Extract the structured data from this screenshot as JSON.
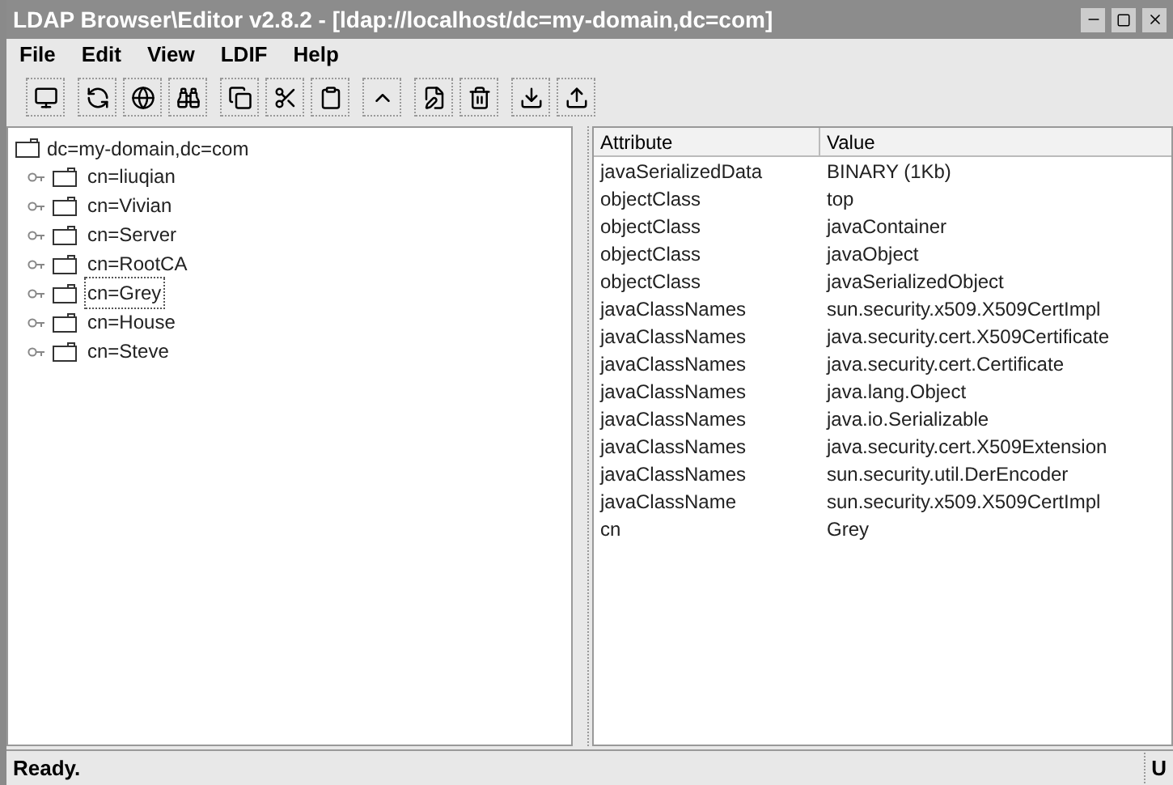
{
  "window": {
    "title": "LDAP Browser\\Editor v2.8.2 - [ldap://localhost/dc=my-domain,dc=com]"
  },
  "menu": [
    "File",
    "Edit",
    "View",
    "LDIF",
    "Help"
  ],
  "tree": {
    "label": "dc=my-domain,dc=com",
    "children": [
      {
        "label": "cn=liuqian",
        "selected": false
      },
      {
        "label": "cn=Vivian",
        "selected": false
      },
      {
        "label": "cn=Server",
        "selected": false
      },
      {
        "label": "cn=RootCA",
        "selected": false
      },
      {
        "label": "cn=Grey",
        "selected": true
      },
      {
        "label": "cn=House",
        "selected": false
      },
      {
        "label": "cn=Steve",
        "selected": false
      }
    ]
  },
  "table": {
    "columns": [
      "Attribute",
      "Value"
    ],
    "rows": [
      [
        "javaSerializedData",
        "BINARY (1Kb)"
      ],
      [
        "objectClass",
        "top"
      ],
      [
        "objectClass",
        "javaContainer"
      ],
      [
        "objectClass",
        "javaObject"
      ],
      [
        "objectClass",
        "javaSerializedObject"
      ],
      [
        "javaClassNames",
        "sun.security.x509.X509CertImpl"
      ],
      [
        "javaClassNames",
        "java.security.cert.X509Certificate"
      ],
      [
        "javaClassNames",
        "java.security.cert.Certificate"
      ],
      [
        "javaClassNames",
        "java.lang.Object"
      ],
      [
        "javaClassNames",
        "java.io.Serializable"
      ],
      [
        "javaClassNames",
        "java.security.cert.X509Extension"
      ],
      [
        "javaClassNames",
        "sun.security.util.DerEncoder"
      ],
      [
        "javaClassName",
        "sun.security.x509.X509CertImpl"
      ],
      [
        "cn",
        "Grey"
      ]
    ]
  },
  "status_bar": {
    "message": "Ready.",
    "indicator": "U"
  }
}
